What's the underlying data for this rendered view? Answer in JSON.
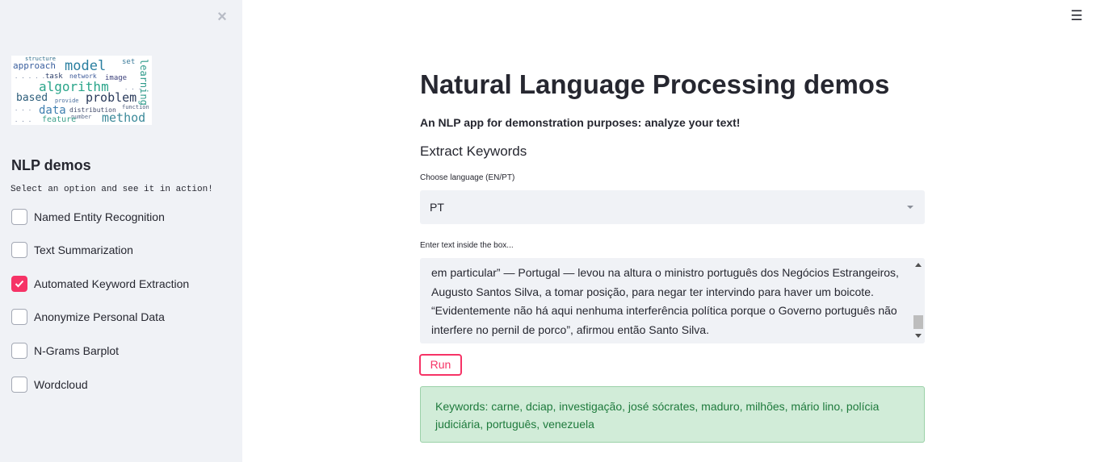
{
  "sidebar": {
    "close_icon": "×",
    "logo_words": [
      "model",
      "algorithm",
      "approach",
      "problem",
      "method",
      "data",
      "based",
      "feature",
      "distribution",
      "network",
      "image",
      "task",
      "provide",
      "number",
      "function",
      "set",
      "learning",
      "structure"
    ],
    "title": "NLP demos",
    "subtitle": "Select an option and see it in action!",
    "options": [
      {
        "label": "Named Entity Recognition",
        "checked": false
      },
      {
        "label": "Text Summarization",
        "checked": false
      },
      {
        "label": "Automated Keyword Extraction",
        "checked": true
      },
      {
        "label": "Anonymize Personal Data",
        "checked": false
      },
      {
        "label": "N-Grams Barplot",
        "checked": false
      },
      {
        "label": "Wordcloud",
        "checked": false
      }
    ]
  },
  "header": {
    "menu_icon": "☰"
  },
  "main": {
    "title": "Natural Language Processing demos",
    "subtitle": "An NLP app for demonstration purposes: analyze your text!",
    "section": "Extract Keywords",
    "language_label": "Choose language (EN/PT)",
    "language_value": "PT",
    "text_label": "Enter text inside the box...",
    "text_value": "em particular” — Portugal — levou na altura o ministro português dos Negócios Estrangeiros, Augusto Santos Silva, a tomar posição, para negar ter intervindo para haver um boicote. “Evidentemente não há aqui nenhuma interferência política porque o Governo português não interfere no pernil de porco”, afirmou então Santo Silva.",
    "run_label": "Run",
    "result_text": "Keywords: carne, dciap, investigação, josé sócrates, maduro, milhões, mário lino, polícia judiciária, português, venezuela"
  },
  "colors": {
    "accent": "#f63366",
    "sidebar_bg": "#f0f2f6",
    "success_bg": "#d1ecd8",
    "success_text": "#1e7a3c"
  }
}
